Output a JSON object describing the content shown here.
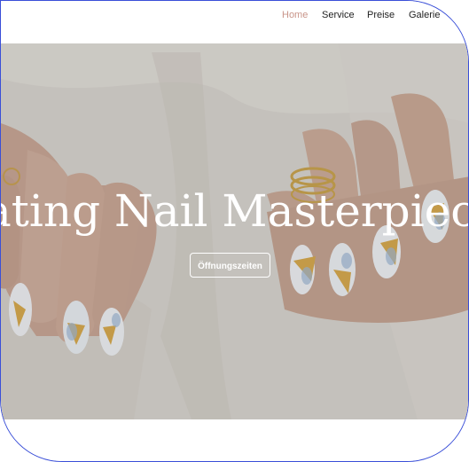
{
  "nav": {
    "items": [
      {
        "label": "Home",
        "active": true
      },
      {
        "label": "Service"
      },
      {
        "label": "Preise"
      },
      {
        "label": "Galerie"
      }
    ],
    "active_color": "#c9958a"
  },
  "hero": {
    "title": "ating Nail Masterpiec",
    "button_label": "Öffnungszeiten",
    "image": "hands-with-manicured-nails-photo"
  },
  "colors": {
    "frame_border": "#3a4fd8",
    "text_on_hero": "#ffffff"
  }
}
